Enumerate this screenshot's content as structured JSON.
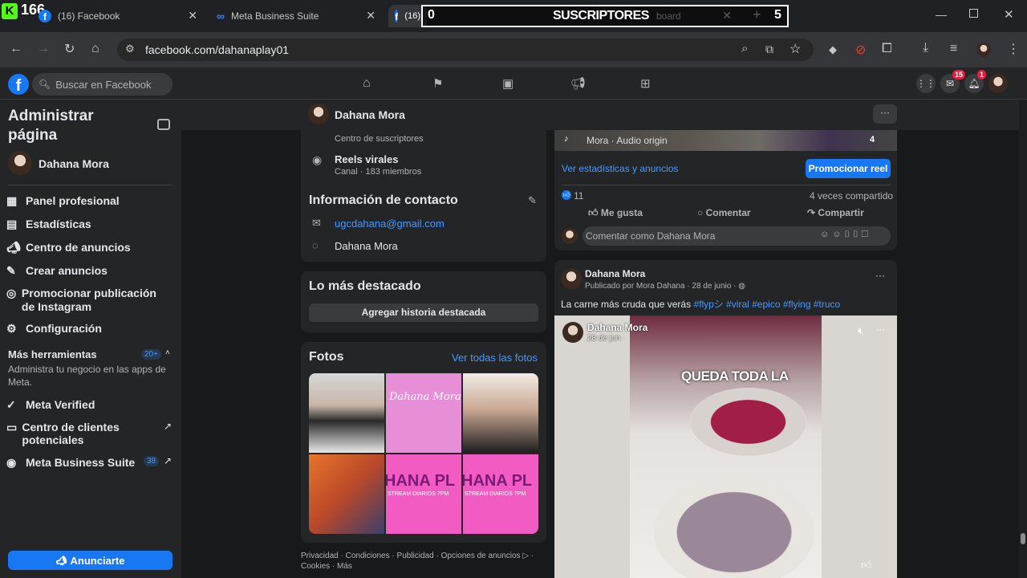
{
  "browser": {
    "tabs": [
      {
        "title": "(16) Facebook"
      },
      {
        "title": "Meta Business Suite"
      },
      {
        "title": "(16) Facebook"
      },
      {
        "title": "board"
      }
    ],
    "url": "facebook.com/dahanaplay01",
    "download_badge": ""
  },
  "overlay": {
    "kick_count": "166",
    "subs_count": "0",
    "subs_label": "SUSCRIPTORES",
    "subs_right": "5"
  },
  "header": {
    "search_placeholder": "Buscar en Facebook",
    "messenger_badge": "15",
    "notif_badge": "1"
  },
  "sidebar": {
    "title_line1": "Administrar",
    "title_line2": "página",
    "profile_name": "Dahana Mora",
    "items": [
      {
        "label": "Panel profesional",
        "icon": "dashboard-icon"
      },
      {
        "label": "Estadísticas",
        "icon": "stats-icon"
      },
      {
        "label": "Centro de anuncios",
        "icon": "megaphone-icon"
      },
      {
        "label": "Crear anuncios",
        "icon": "edit-icon"
      },
      {
        "label": "Promocionar publicación de Instagram",
        "icon": "instagram-icon"
      },
      {
        "label": "Configuración",
        "icon": "gear-icon"
      }
    ],
    "more_tools": {
      "label": "Más herramientas",
      "badge": "20+",
      "desc": "Administra tu negocio en las apps de Meta."
    },
    "tools": [
      {
        "label": "Meta Verified",
        "icon": "verified-icon"
      },
      {
        "label": "Centro de clientes potenciales",
        "icon": "contacts-icon"
      },
      {
        "label": "Meta Business Suite",
        "icon": "business-suite-icon",
        "badge": "38"
      }
    ],
    "cta_label": "Anunciarte"
  },
  "page": {
    "name": "Dahana Mora",
    "subscribers_center": "Centro de suscriptores",
    "channel_name": "Reels virales",
    "channel_meta": "Canal · 183 miembros",
    "contact_title": "Información de contacto",
    "email": "ugcdahana@gmail.com",
    "messenger_name": "Dahana Mora",
    "highlights_title": "Lo más destacado",
    "highlights_button": "Agregar historia destacada",
    "photos_title": "Fotos",
    "photos_link": "Ver todas las fotos",
    "photo_texts": {
      "logo_name": "Dahana Mora",
      "banner1": "HANA PL",
      "banner_sub1": "STREAM DIARIOS 7PM",
      "banner2": "HANA PL",
      "banner_sub2": "STREAM DIARIOS 7PM"
    },
    "footer_links": [
      "Privacidad",
      "Condiciones",
      "Publicidad",
      "Opciones de anuncios",
      "Cookies",
      "Más"
    ]
  },
  "post1": {
    "audio_label": "Mora · Audio origin",
    "count": "4",
    "stats_link": "Ver estadísticas y anuncios",
    "promote_button": "Promocionar reel",
    "likes": "11",
    "shares": "4 veces compartido",
    "like_label": "Me gusta",
    "comment_label": "Comentar",
    "share_label": "Compartir",
    "comment_placeholder": "Comentar como Dahana Mora"
  },
  "post2": {
    "author": "Dahana Mora",
    "meta": "Publicado por Mora Dahana · 28 de junio ·",
    "caption_text": "La carne más cruda que verás",
    "hashtags": "#flypシ #viral #epico #flying #truco",
    "video_author": "Dahana Mora",
    "video_date": "28 de jun ·",
    "video_caption": "QUEDA TODA LA"
  },
  "colors": {
    "accent": "#1877f2",
    "link": "#4599ff",
    "bg": "#18191a",
    "card": "#242526"
  }
}
